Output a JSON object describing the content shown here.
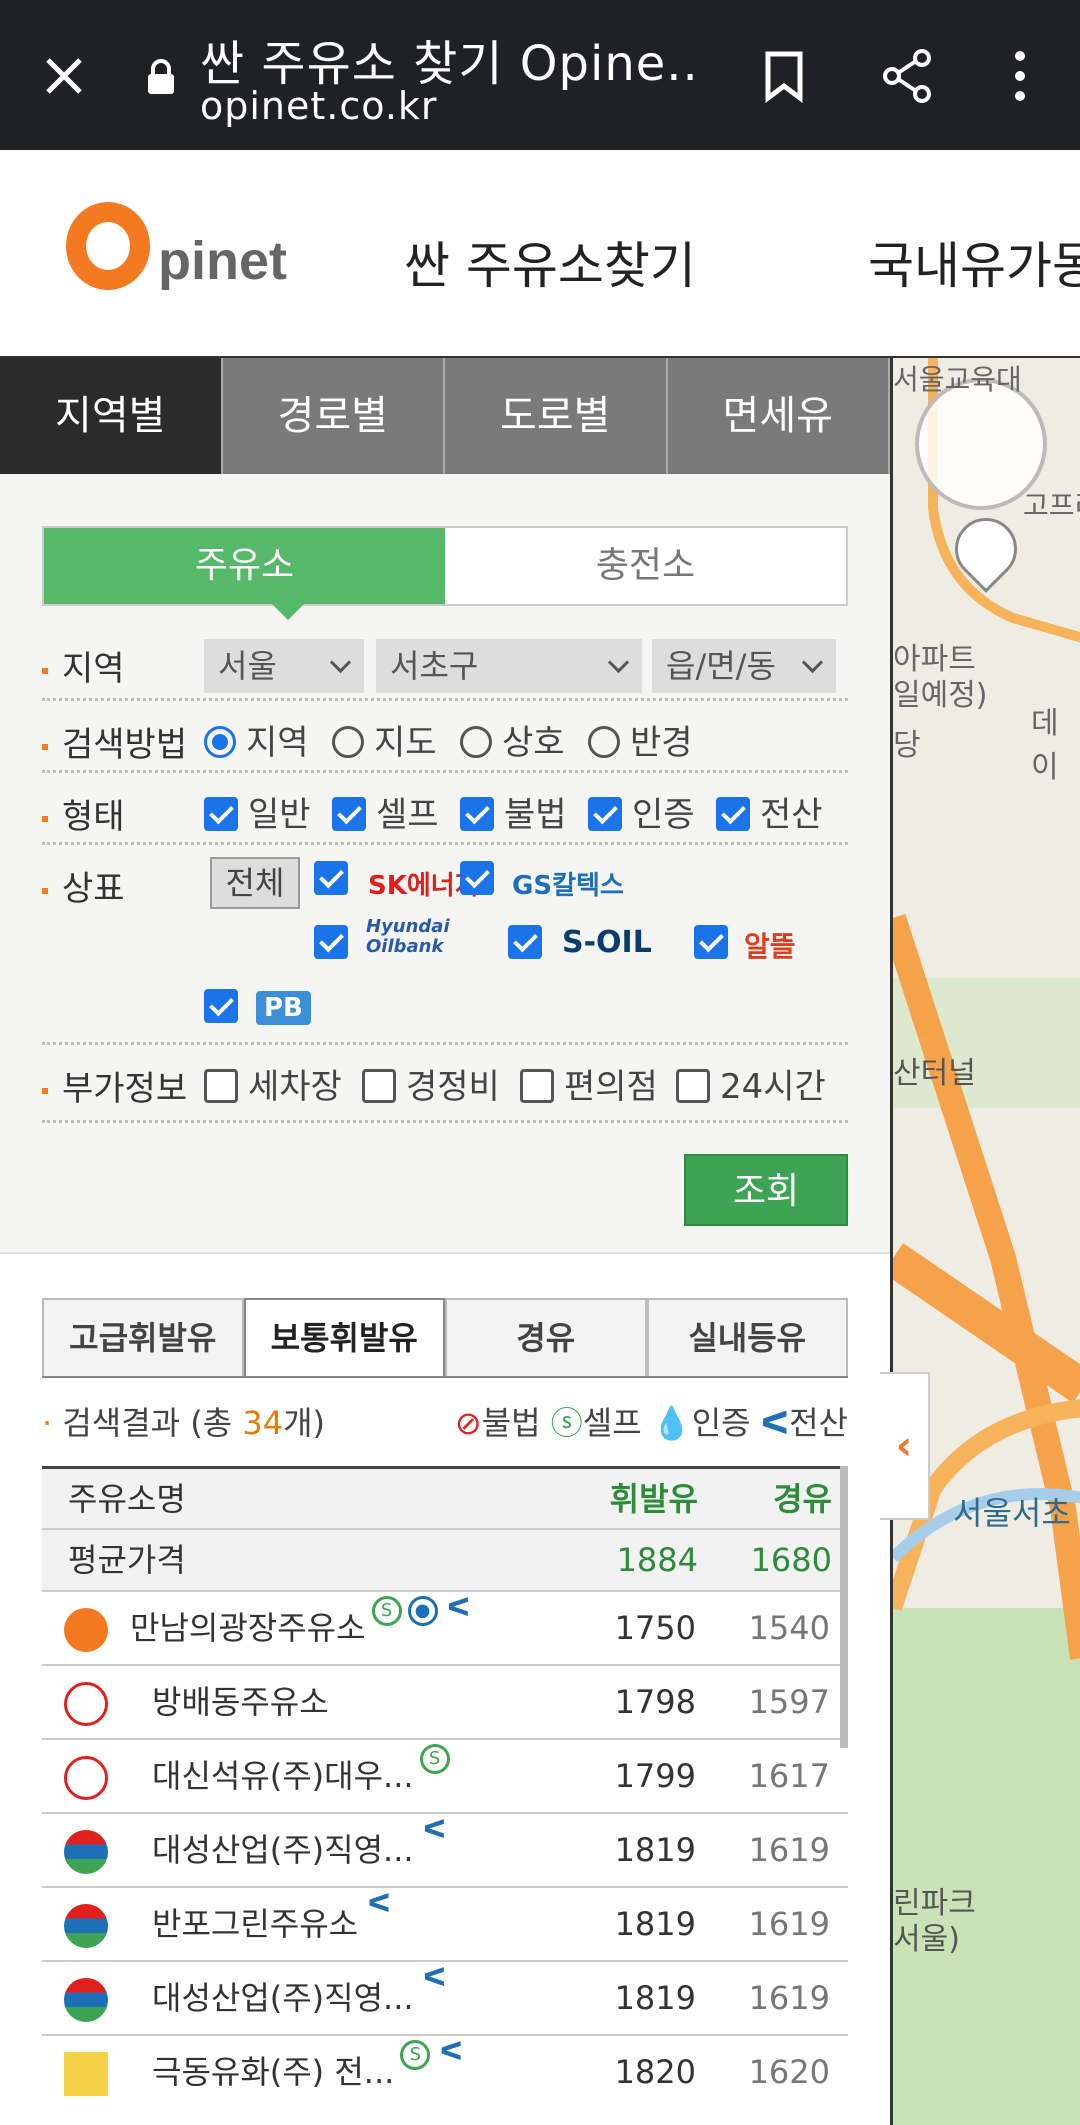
{
  "browser": {
    "title": "싼 주유소 찾기 Opine...",
    "url": "opinet.co.kr"
  },
  "header": {
    "logo_o": "O",
    "logo_rest": "pinet",
    "nav1": "싼 주유소찾기",
    "nav2": "국내유가동"
  },
  "tabs": [
    "지역별",
    "경로별",
    "도로별",
    "면세유"
  ],
  "segment": {
    "left": "주유소",
    "right": "충전소"
  },
  "filters": {
    "region_label": "지역",
    "region_sido": "서울",
    "region_gu": "서초구",
    "region_dong": "읍/면/동",
    "method_label": "검색방법",
    "methods": [
      "지역",
      "지도",
      "상호",
      "반경"
    ],
    "type_label": "형태",
    "types": [
      "일반",
      "셀프",
      "불법",
      "인증",
      "전산"
    ],
    "brand_label": "상표",
    "brand_all": "전체",
    "brands": [
      "SK에너지",
      "GS칼텍스",
      "Hyundai Oilbank",
      "S-OIL",
      "알뜰",
      "PB"
    ],
    "extra_label": "부가정보",
    "extras": [
      "세차장",
      "경정비",
      "편의점",
      "24시간"
    ],
    "search_button": "조회"
  },
  "fuel_tabs": [
    "고급휘발유",
    "보통휘발유",
    "경유",
    "실내등유"
  ],
  "result": {
    "prefix": "검색결과 (총 ",
    "count": "34",
    "suffix": "개)",
    "legend_illegal": "불법",
    "legend_self": "셀프",
    "legend_cert": "인증",
    "legend_pos": "전산"
  },
  "table": {
    "headers": {
      "name": "주유소명",
      "gasoline": "휘발유",
      "diesel": "경유"
    },
    "average": {
      "label": "평균가격",
      "gasoline": "1884",
      "diesel": "1680"
    },
    "rows": [
      {
        "brand": "al-tteul-icon",
        "name": "만남의광장주유소",
        "gasoline": "1750",
        "diesel": "1540"
      },
      {
        "brand": "sk-icon",
        "name": "방배동주유소",
        "gasoline": "1798",
        "diesel": "1597"
      },
      {
        "brand": "sk-icon",
        "name": "대신석유(주)대우...",
        "gasoline": "1799",
        "diesel": "1617"
      },
      {
        "brand": "gs-icon",
        "name": "대성산업(주)직영...",
        "gasoline": "1819",
        "diesel": "1619"
      },
      {
        "brand": "gs-icon",
        "name": "반포그린주유소",
        "gasoline": "1819",
        "diesel": "1619"
      },
      {
        "brand": "gs-icon",
        "name": "대성산업(주)직영...",
        "gasoline": "1819",
        "diesel": "1619"
      },
      {
        "brand": "s-oil-icon",
        "name": "극동유화(주) 전...",
        "gasoline": "1820",
        "diesel": "1620"
      }
    ]
  },
  "map": {
    "labels": [
      "서울교육대",
      "아파트",
      "일예정)",
      "당",
      "데이",
      "산터널",
      "서울서초",
      "린파크",
      "서울)",
      "고프리"
    ]
  },
  "colors": {
    "accent": "#f47920",
    "green": "#3ea354",
    "blue": "#1a73e8"
  }
}
